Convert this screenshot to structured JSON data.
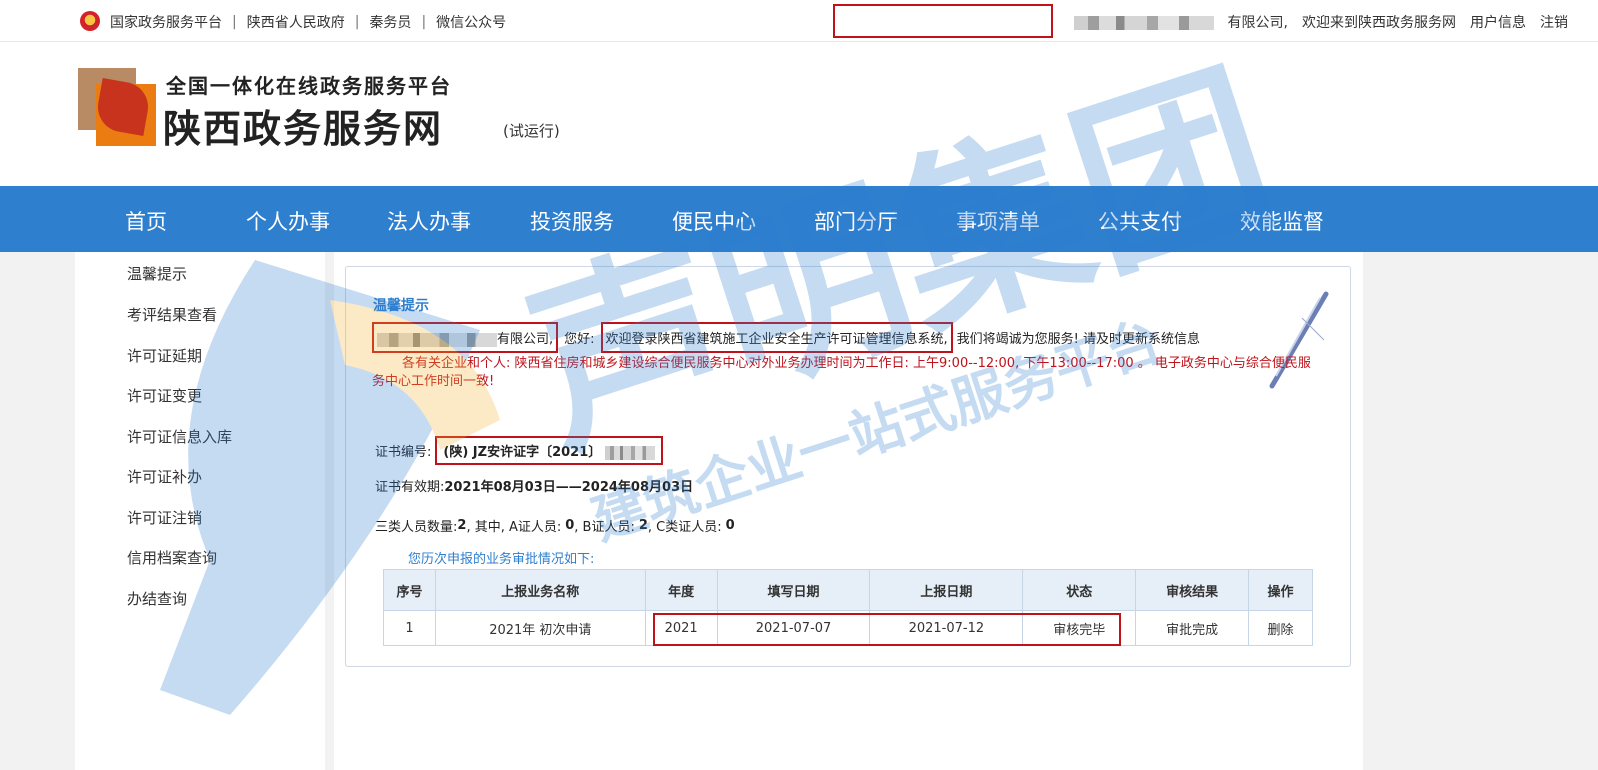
{
  "topbar": {
    "links": [
      "国家政务服务平台",
      "陕西省人民政府",
      "秦务员",
      "微信公众号"
    ],
    "separators": [
      "|",
      "|",
      "|"
    ],
    "company_suffix": "有限公司,",
    "welcome": "欢迎来到陕西政务服务网",
    "user_info": "用户信息",
    "logout": "注销"
  },
  "header": {
    "platform_sub": "全国一体化在线政务服务平台",
    "site_name": "陕西政务服务网",
    "trial": "(试运行)"
  },
  "nav": [
    "首页",
    "个人办事",
    "法人办事",
    "投资服务",
    "便民中心",
    "部门分厅",
    "事项清单",
    "公共支付",
    "效能监督"
  ],
  "sidebar": [
    "温馨提示",
    "考评结果查看",
    "许可证延期",
    "许可证变更",
    "许可证信息入库",
    "许可证补办",
    "许可证注销",
    "信用档案查询",
    "办结查询"
  ],
  "content": {
    "tip_title": "温馨提示",
    "company_suffix": "有限公司,",
    "hello": "您好:",
    "welcome_system": "欢迎登录陕西省建筑施工企业安全生产许可证管理信息系统,",
    "service_text": "我们将竭诚为您服务! 请及时更新系统信息",
    "notice": "各有关企业和个人: 陕西省住房和城乡建设综合便民服务中心对外业务办理时间为工作日: 上午9:00--12:00, 下午13:00--17:00 。 电子政务中心与综合便民服务中心工作时间一致!",
    "cert_no_label": "证书编号:",
    "cert_no_value": "(陕) JZ安许证字〔2021〕",
    "validity_label": "证书有效期:",
    "validity_value": "2021年08月03日——2024年08月03日",
    "staff_label": "三类人员数量:",
    "staff_total": "2",
    "staff_detail_a_label": ", 其中, A证人员:",
    "staff_a": "0",
    "staff_detail_b_label": ", B证人员:",
    "staff_b": "2",
    "staff_detail_c_label": ", C类证人员:",
    "staff_c": "0",
    "history_label": "您历次申报的业务审批情况如下:"
  },
  "table": {
    "headers": [
      "序号",
      "上报业务名称",
      "年度",
      "填写日期",
      "上报日期",
      "状态",
      "审核结果",
      "操作"
    ],
    "rows": [
      {
        "no": "1",
        "name": "2021年 初次申请",
        "year": "2021",
        "fill_date": "2021-07-07",
        "report_date": "2021-07-12",
        "status": "审核完毕",
        "result": "审批完成",
        "action": "删除"
      }
    ]
  },
  "watermark": {
    "big": "声明集团",
    "small": "建筑企业一站式服务平台"
  },
  "colors": {
    "nav_bg": "#2f7fcf",
    "link": "#2f7fcf",
    "highlight_box": "#c0121a",
    "notice_text": "#c0121a"
  }
}
